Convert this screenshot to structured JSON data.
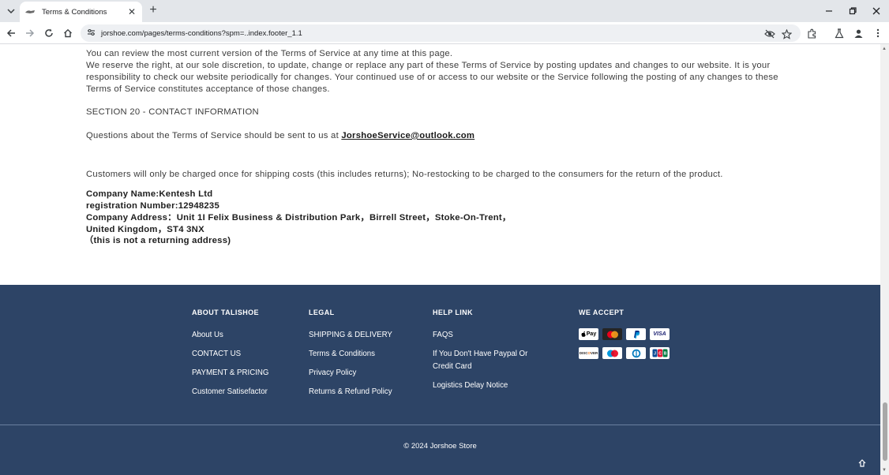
{
  "browser": {
    "tab_title": "Terms & Conditions",
    "url": "jorshoe.com/pages/terms-conditions?spm=..index.footer_1.1",
    "icons": [
      "tab-list-icon",
      "favicon-icon",
      "close-icon",
      "new-tab-icon",
      "minimize-icon",
      "restore-icon",
      "close-window-icon",
      "back-icon",
      "forward-icon",
      "reload-icon",
      "home-icon",
      "site-info-icon",
      "eye-off-icon",
      "star-icon",
      "extensions-icon",
      "lab-icon",
      "profile-icon",
      "menu-icon"
    ]
  },
  "content": {
    "line1": "You can review the most current version of the Terms of Service at any time at this page.",
    "line2": "We reserve the right, at our sole discretion, to update, change or replace any part of these Terms of Service by posting updates and changes to our website. It is your",
    "line3": "responsibility to check our website periodically for changes. Your continued use of or access to our website or the Service following the posting of any changes to these",
    "line4": "Terms of Service constitutes acceptance of those changes.",
    "section_heading": "SECTION 20 - CONTACT INFORMATION",
    "questions_text": "Questions about the Terms of Service should be sent to us at ",
    "email": "JorshoeService@outlook.com",
    "shipping_note": "Customers will only be charged once for shipping costs (this includes returns); No-restocking to be charged to the consumers for the return of the product.",
    "company_name": "Company Name:Kentesh Ltd",
    "registration": "registration Number:12948235",
    "address_line1": "Company Address：Unit 1I Felix Business & Distribution Park，Birrell Street，Stoke-On-Trent，",
    "address_line2": "United Kingdom，ST4 3NX",
    "address_note": "（this is not  a returning address)"
  },
  "footer": {
    "col1": {
      "heading": "ABOUT TALISHOE",
      "links": [
        "About Us",
        "CONTACT US",
        "PAYMENT & PRICING",
        "Customer Satisefactor"
      ]
    },
    "col2": {
      "heading": "LEGAL",
      "links": [
        "SHIPPING & DELIVERY",
        "Terms & Conditions",
        "Privacy Policy",
        "Returns & Refund Policy"
      ]
    },
    "col3": {
      "heading": "HELP LINK",
      "links": [
        "FAQS",
        "If You Don't Have Paypal Or",
        "Credit Card",
        "Logistics Delay Notice"
      ]
    },
    "col4": {
      "heading": "WE ACCEPT",
      "payment_methods": [
        "Apple Pay",
        "Mastercard",
        "PayPal",
        "VISA",
        "DISCOVER",
        "Maestro",
        "Diners Club",
        "JCB"
      ]
    },
    "copyright": "© 2024 Jorshoe Store",
    "bg_color": "#2d4466"
  }
}
